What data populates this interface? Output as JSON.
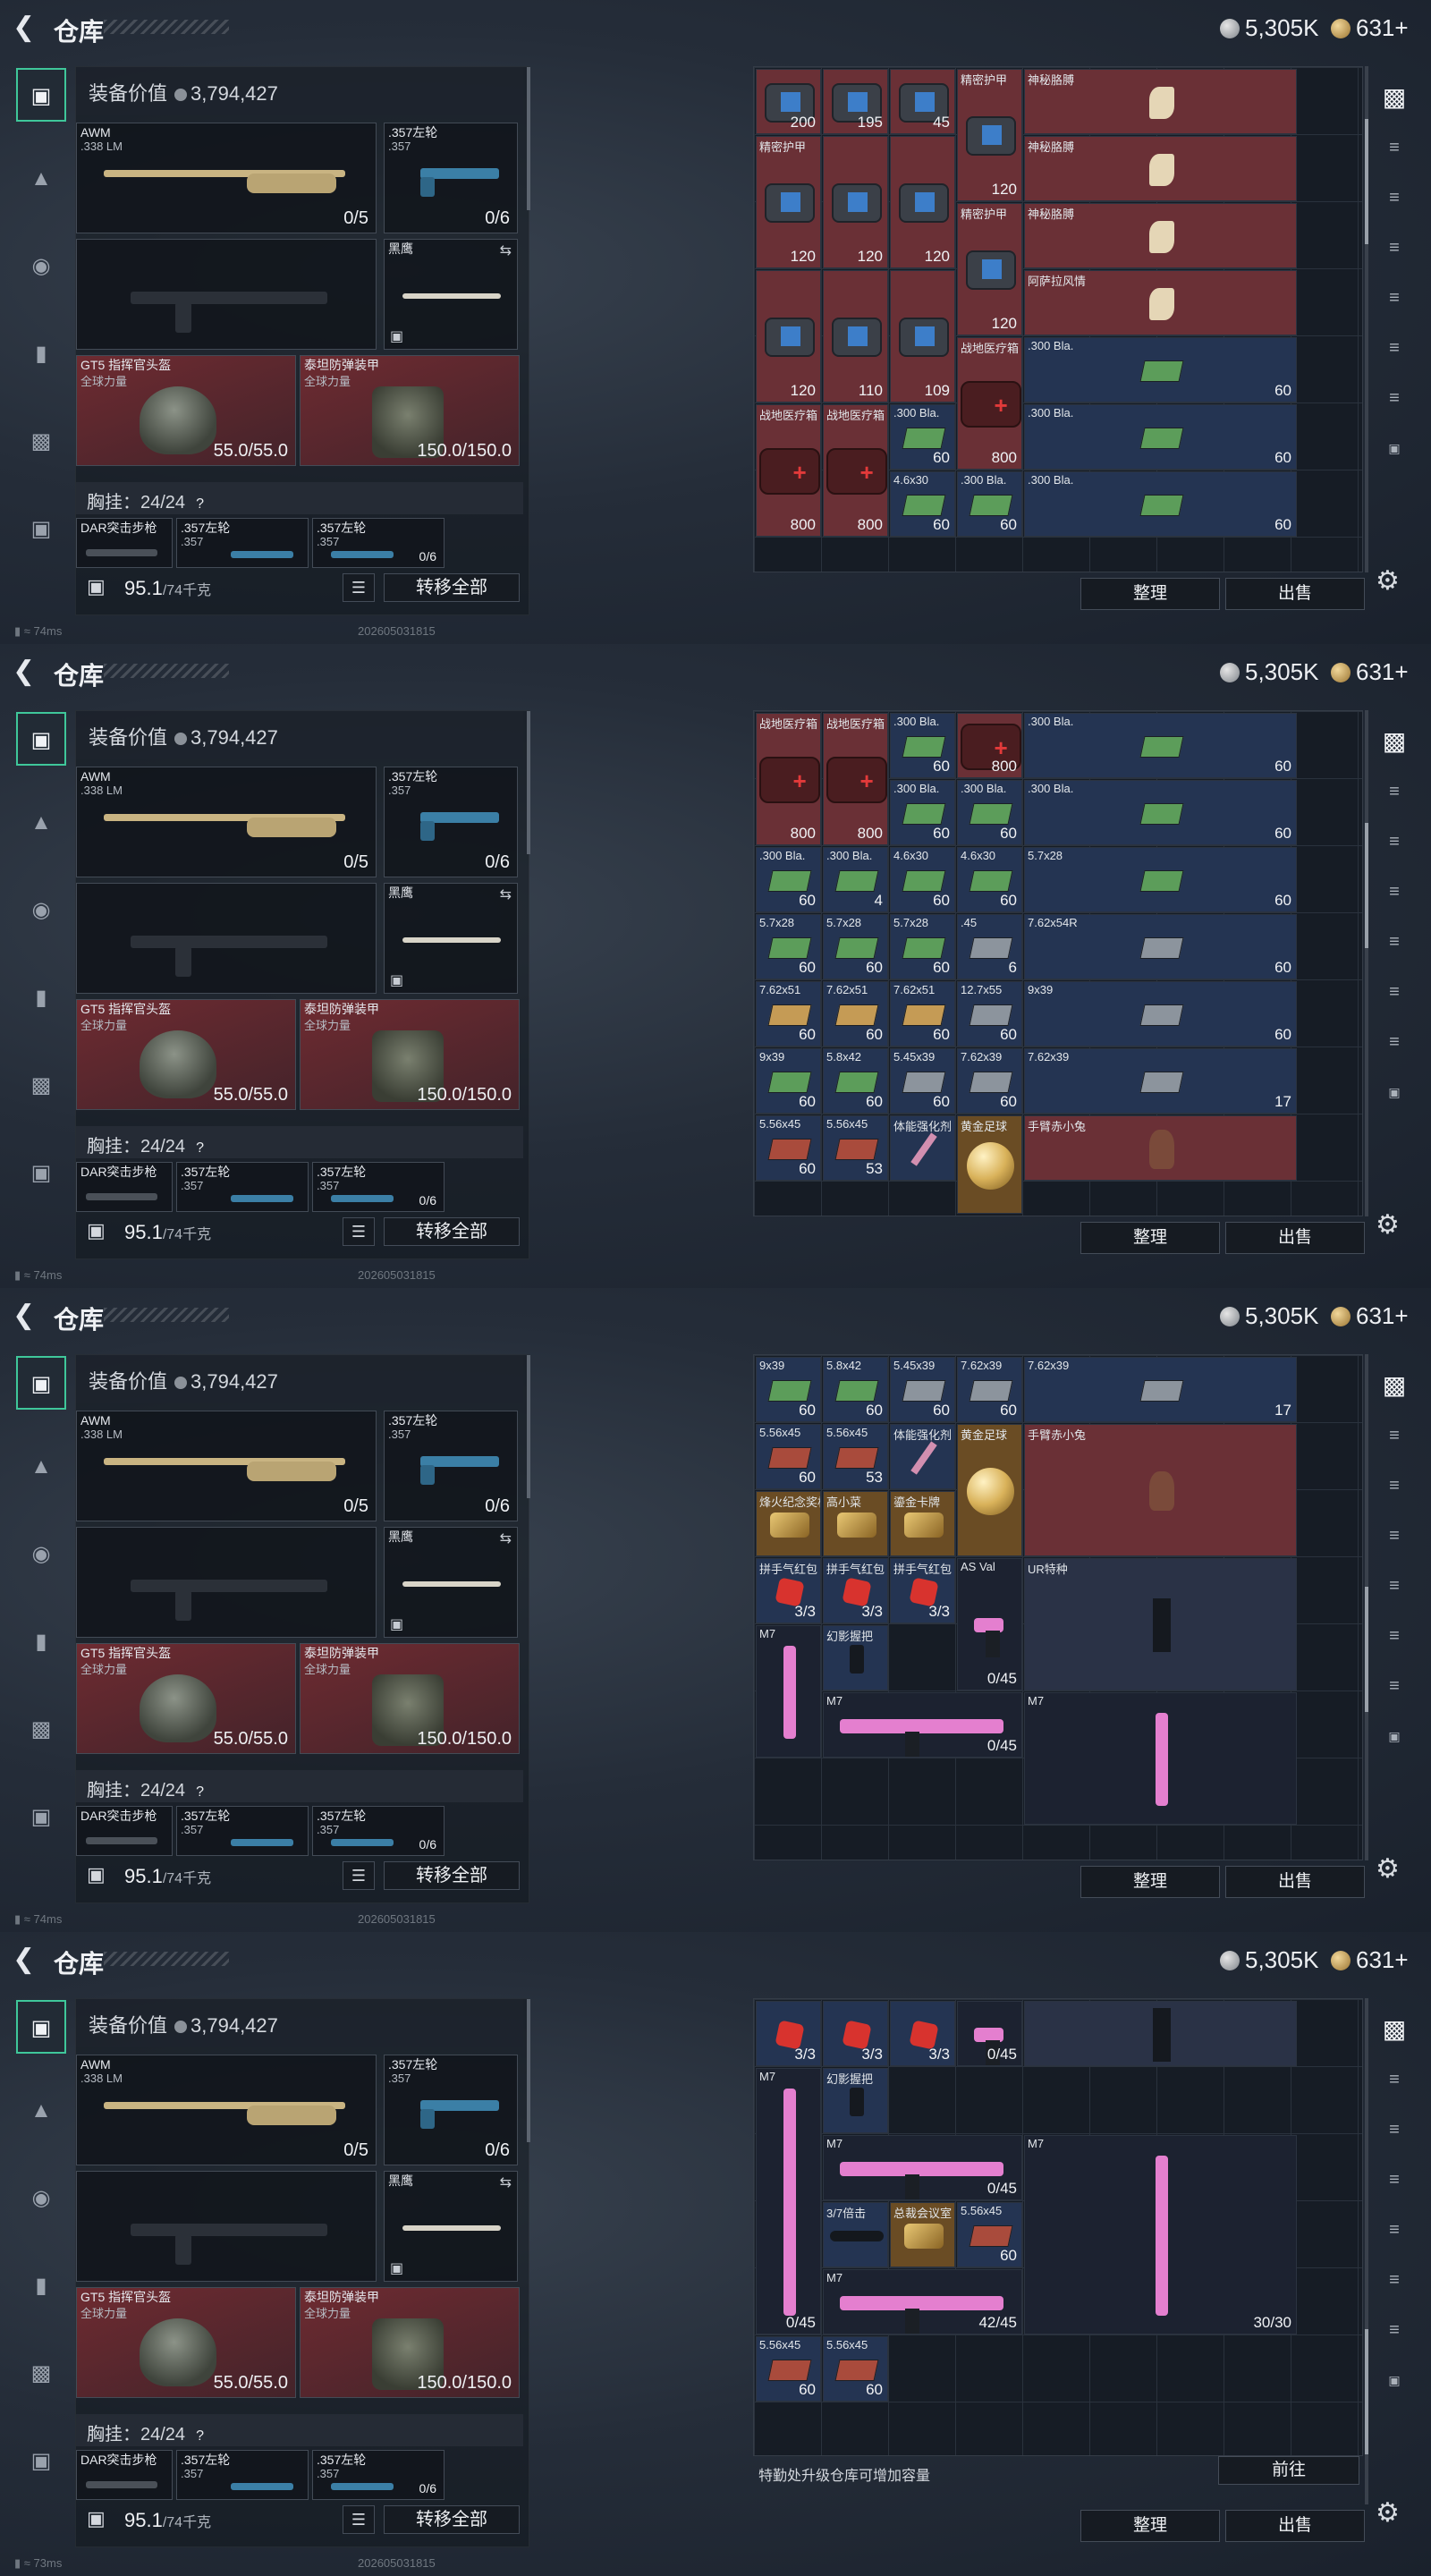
{
  "title": "仓库",
  "currency": {
    "silver": "5,305K",
    "gold": "631+"
  },
  "left": {
    "value_label": "装备价值",
    "value": "3,794,427",
    "slots": {
      "primary": {
        "name": "AWM",
        "sub": ".338 LM",
        "count": "0/5"
      },
      "secondary": {
        "name": ".357左轮",
        "sub": ".357",
        "count": "0/6"
      },
      "melee": {
        "name": "黑鹰"
      },
      "helmet": {
        "name": "GT5 指挥官头盔",
        "sub": "全球力量",
        "durability": "55.0/55.0"
      },
      "armor": {
        "name": "泰坦防弹装甲",
        "sub": "全球力量",
        "durability": "150.0/150.0"
      }
    },
    "chest": {
      "label": "胸挂：",
      "value": "24/24",
      "q": "?"
    },
    "chest_items": [
      {
        "name": "DAR突击步枪"
      },
      {
        "name": ".357左轮",
        "sub": ".357"
      },
      {
        "name": ".357左轮",
        "sub": ".357",
        "count": "0/6"
      }
    ],
    "weight": "95.1",
    "weight_max": "/74千克",
    "transfer_all": "转移全部"
  },
  "status": {
    "ping1": "74ms",
    "ping4": "73ms",
    "timestamp": "202605031815"
  },
  "buttons": {
    "sort": "整理",
    "sell": "出售",
    "goto": "前往"
  },
  "notice": "特勤处升级仓库可增加容量",
  "colors": {
    "accent": "#3fc79a",
    "red_slot": "#6e2b31",
    "pink": "#e47fcf"
  },
  "views": [
    {
      "thumb": 0.14,
      "cells": [
        {
          "c": 0,
          "r": 0,
          "w": 1,
          "h": 1,
          "bg": "#6a3036",
          "icon": "armor-bag",
          "cnt": "200"
        },
        {
          "c": 1,
          "r": 0,
          "w": 1,
          "h": 1,
          "bg": "#6a3036",
          "icon": "armor-bag",
          "cnt": "195"
        },
        {
          "c": 2,
          "r": 0,
          "w": 1,
          "h": 1,
          "bg": "#6a3036",
          "icon": "armor-bag",
          "cnt": "45"
        },
        {
          "c": 3,
          "r": 0,
          "w": 1,
          "h": 2,
          "bg": "#6a3036",
          "icon": "armor-bag",
          "name": "精密护甲",
          "cnt": "120"
        },
        {
          "c": 4,
          "r": 0,
          "w": 1,
          "h": 1,
          "bg": "#6a3036",
          "icon": "arm",
          "name": "神秘胳膊"
        },
        {
          "c": 0,
          "r": 1,
          "w": 1,
          "h": 2,
          "bg": "#6a3036",
          "icon": "armor-bag",
          "name": "精密护甲",
          "cnt": "120"
        },
        {
          "c": 1,
          "r": 1,
          "w": 1,
          "h": 2,
          "bg": "#6a3036",
          "icon": "armor-bag",
          "cnt": "120"
        },
        {
          "c": 2,
          "r": 1,
          "w": 1,
          "h": 2,
          "bg": "#6a3036",
          "icon": "armor-bag",
          "cnt": "120"
        },
        {
          "c": 4,
          "r": 1,
          "w": 1,
          "h": 1,
          "bg": "#6a3036",
          "icon": "arm",
          "name": "神秘胳膊"
        },
        {
          "c": 3,
          "r": 2,
          "w": 1,
          "h": 2,
          "bg": "#6a3036",
          "icon": "armor-bag",
          "name": "精密护甲",
          "cnt": "120"
        },
        {
          "c": 4,
          "r": 2,
          "w": 1,
          "h": 1,
          "bg": "#6a3036",
          "icon": "arm",
          "name": "神秘胳膊"
        },
        {
          "c": 0,
          "r": 3,
          "w": 1,
          "h": 2,
          "bg": "#6a3036",
          "icon": "armor-bag",
          "cnt": "120"
        },
        {
          "c": 1,
          "r": 3,
          "w": 1,
          "h": 2,
          "bg": "#6a3036",
          "icon": "armor-bag",
          "cnt": "110"
        },
        {
          "c": 2,
          "r": 3,
          "w": 1,
          "h": 2,
          "bg": "#6a3036",
          "icon": "armor-bag",
          "cnt": "109"
        },
        {
          "c": 4,
          "r": 3,
          "w": 1,
          "h": 1,
          "bg": "#6a3036",
          "icon": "arm",
          "name": "阿萨拉风情"
        },
        {
          "c": 3,
          "r": 4,
          "w": 1,
          "h": 2,
          "bg": "#6a3036",
          "icon": "medkit",
          "name": "战地医疗箱",
          "cnt": "800"
        },
        {
          "c": 0,
          "r": 5,
          "w": 1,
          "h": 2,
          "bg": "#6a3036",
          "icon": "medkit",
          "name": "战地医疗箱",
          "cnt": "800"
        },
        {
          "c": 1,
          "r": 5,
          "w": 1,
          "h": 2,
          "bg": "#6a3036",
          "icon": "medkit",
          "name": "战地医疗箱",
          "cnt": "800"
        },
        {
          "c": 2,
          "r": 5,
          "w": 1,
          "h": 1,
          "bg": "#243452",
          "icon": "ammo-green",
          "name": ".300 Bla.",
          "cnt": "60"
        },
        {
          "c": 4,
          "r": 4,
          "w": 1,
          "h": 1,
          "bg": "#243452",
          "icon": "ammo-green",
          "name": ".300 Bla.",
          "cnt": "60"
        },
        {
          "c": 4,
          "r": 5,
          "w": 1,
          "h": 1,
          "bg": "#243452",
          "icon": "ammo-green",
          "name": ".300 Bla.",
          "cnt": "60"
        },
        {
          "c": 2,
          "r": 6,
          "w": 1,
          "h": 1,
          "bg": "#243452",
          "icon": "ammo-green",
          "name": "4.6x30",
          "cnt": "60"
        },
        {
          "c": 3,
          "r": 6,
          "w": 1,
          "h": 1,
          "bg": "#243452",
          "icon": "ammo-green",
          "name": ".300 Bla.",
          "cnt": "60"
        },
        {
          "c": 4,
          "r": 6,
          "w": 1,
          "h": 1,
          "bg": "#243452",
          "icon": "ammo-green",
          "name": ".300 Bla.",
          "cnt": "60"
        }
      ]
    },
    {
      "thumb": 0.3,
      "cells": [
        {
          "c": 0,
          "r": 0,
          "w": 1,
          "h": 2,
          "bg": "#6a3036",
          "icon": "medkit",
          "name": "战地医疗箱",
          "cnt": "800"
        },
        {
          "c": 1,
          "r": 0,
          "w": 1,
          "h": 2,
          "bg": "#6a3036",
          "icon": "medkit",
          "name": "战地医疗箱",
          "cnt": "800"
        },
        {
          "c": 2,
          "r": 0,
          "w": 1,
          "h": 1,
          "bg": "#243452",
          "icon": "ammo-green",
          "name": ".300 Bla.",
          "cnt": "60"
        },
        {
          "c": 3,
          "r": 0,
          "w": 1,
          "h": 1,
          "bg": "#6a3036",
          "icon": "medkit",
          "cnt": "800"
        },
        {
          "c": 4,
          "r": 0,
          "w": 1,
          "h": 1,
          "bg": "#243452",
          "icon": "ammo-green",
          "name": ".300 Bla.",
          "cnt": "60"
        },
        {
          "c": 2,
          "r": 1,
          "w": 1,
          "h": 1,
          "bg": "#243452",
          "icon": "ammo-green",
          "name": ".300 Bla.",
          "cnt": "60"
        },
        {
          "c": 3,
          "r": 1,
          "w": 1,
          "h": 1,
          "bg": "#243452",
          "icon": "ammo-green",
          "name": ".300 Bla.",
          "cnt": "60"
        },
        {
          "c": 4,
          "r": 1,
          "w": 1,
          "h": 1,
          "bg": "#243452",
          "icon": "ammo-green",
          "name": ".300 Bla.",
          "cnt": "60"
        },
        {
          "c": 0,
          "r": 2,
          "w": 1,
          "h": 1,
          "bg": "#243452",
          "icon": "ammo-green",
          "name": ".300 Bla.",
          "cnt": "60"
        },
        {
          "c": 1,
          "r": 2,
          "w": 1,
          "h": 1,
          "bg": "#243452",
          "icon": "ammo-green",
          "name": ".300 Bla.",
          "cnt": "4"
        },
        {
          "c": 2,
          "r": 2,
          "w": 1,
          "h": 1,
          "bg": "#243452",
          "icon": "ammo-green",
          "name": "4.6x30",
          "cnt": "60"
        },
        {
          "c": 3,
          "r": 2,
          "w": 1,
          "h": 1,
          "bg": "#243452",
          "icon": "ammo-green",
          "name": "4.6x30",
          "cnt": "60"
        },
        {
          "c": 4,
          "r": 2,
          "w": 1,
          "h": 1,
          "bg": "#243452",
          "icon": "ammo-green",
          "name": "5.7x28",
          "cnt": "60"
        },
        {
          "c": 0,
          "r": 3,
          "w": 1,
          "h": 1,
          "bg": "#243452",
          "icon": "ammo-green",
          "name": "5.7x28",
          "cnt": "60"
        },
        {
          "c": 1,
          "r": 3,
          "w": 1,
          "h": 1,
          "bg": "#243452",
          "icon": "ammo-green",
          "name": "5.7x28",
          "cnt": "60"
        },
        {
          "c": 2,
          "r": 3,
          "w": 1,
          "h": 1,
          "bg": "#243452",
          "icon": "ammo-green",
          "name": "5.7x28",
          "cnt": "60"
        },
        {
          "c": 3,
          "r": 3,
          "w": 1,
          "h": 1,
          "bg": "#243452",
          "icon": "ammo-gray",
          "name": ".45",
          "cnt": "6"
        },
        {
          "c": 4,
          "r": 3,
          "w": 1,
          "h": 1,
          "bg": "#243452",
          "icon": "ammo-gray",
          "name": "7.62x54R",
          "cnt": "60"
        },
        {
          "c": 0,
          "r": 4,
          "w": 1,
          "h": 1,
          "bg": "#243452",
          "icon": "ammo-tan",
          "name": "7.62x51",
          "cnt": "60"
        },
        {
          "c": 1,
          "r": 4,
          "w": 1,
          "h": 1,
          "bg": "#243452",
          "icon": "ammo-tan",
          "name": "7.62x51",
          "cnt": "60"
        },
        {
          "c": 2,
          "r": 4,
          "w": 1,
          "h": 1,
          "bg": "#243452",
          "icon": "ammo-tan",
          "name": "7.62x51",
          "cnt": "60"
        },
        {
          "c": 3,
          "r": 4,
          "w": 1,
          "h": 1,
          "bg": "#243452",
          "icon": "ammo-gray",
          "name": "12.7x55",
          "cnt": "60"
        },
        {
          "c": 4,
          "r": 4,
          "w": 1,
          "h": 1,
          "bg": "#243452",
          "icon": "ammo-gray",
          "name": "9x39",
          "cnt": "60"
        },
        {
          "c": 0,
          "r": 5,
          "w": 1,
          "h": 1,
          "bg": "#243452",
          "icon": "ammo-green",
          "name": "9x39",
          "cnt": "60"
        },
        {
          "c": 1,
          "r": 5,
          "w": 1,
          "h": 1,
          "bg": "#243452",
          "icon": "ammo-green",
          "name": "5.8x42",
          "cnt": "60"
        },
        {
          "c": 2,
          "r": 5,
          "w": 1,
          "h": 1,
          "bg": "#243452",
          "icon": "ammo-gray",
          "name": "5.45x39",
          "cnt": "60"
        },
        {
          "c": 3,
          "r": 5,
          "w": 1,
          "h": 1,
          "bg": "#243452",
          "icon": "ammo-gray",
          "name": "7.62x39",
          "cnt": "60"
        },
        {
          "c": 4,
          "r": 5,
          "w": 1,
          "h": 1,
          "bg": "#243452",
          "icon": "ammo-gray",
          "name": "7.62x39",
          "cnt": "17"
        },
        {
          "c": 0,
          "r": 6,
          "w": 1,
          "h": 1,
          "bg": "#243452",
          "icon": "ammo-red",
          "name": "5.56x45",
          "cnt": "60"
        },
        {
          "c": 1,
          "r": 6,
          "w": 1,
          "h": 1,
          "bg": "#243452",
          "icon": "ammo-red",
          "name": "5.56x45",
          "cnt": "53"
        },
        {
          "c": 2,
          "r": 6,
          "w": 1,
          "h": 1,
          "bg": "#243452",
          "icon": "syringe",
          "name": "体能强化剂"
        },
        {
          "c": 3,
          "r": 6,
          "w": 1,
          "h": 2,
          "bg": "#6a4c24",
          "icon": "gold-ball",
          "name": "黄金足球"
        },
        {
          "c": 4,
          "r": 6,
          "w": 1,
          "h": 1,
          "bg": "#6a3036",
          "icon": "figure",
          "name": "手臂赤小兔"
        }
      ]
    },
    {
      "thumb": 0.62,
      "cells": [
        {
          "c": 0,
          "r": 0,
          "w": 1,
          "h": 1,
          "bg": "#243452",
          "icon": "ammo-green",
          "name": "9x39",
          "cnt": "60"
        },
        {
          "c": 1,
          "r": 0,
          "w": 1,
          "h": 1,
          "bg": "#243452",
          "icon": "ammo-green",
          "name": "5.8x42",
          "cnt": "60"
        },
        {
          "c": 2,
          "r": 0,
          "w": 1,
          "h": 1,
          "bg": "#243452",
          "icon": "ammo-gray",
          "name": "5.45x39",
          "cnt": "60"
        },
        {
          "c": 3,
          "r": 0,
          "w": 1,
          "h": 1,
          "bg": "#243452",
          "icon": "ammo-gray",
          "name": "7.62x39",
          "cnt": "60"
        },
        {
          "c": 4,
          "r": 0,
          "w": 1,
          "h": 1,
          "bg": "#243452",
          "icon": "ammo-gray",
          "name": "7.62x39",
          "cnt": "17"
        },
        {
          "c": 0,
          "r": 1,
          "w": 1,
          "h": 1,
          "bg": "#243452",
          "icon": "ammo-red",
          "name": "5.56x45",
          "cnt": "60"
        },
        {
          "c": 1,
          "r": 1,
          "w": 1,
          "h": 1,
          "bg": "#243452",
          "icon": "ammo-red",
          "name": "5.56x45",
          "cnt": "53"
        },
        {
          "c": 2,
          "r": 1,
          "w": 1,
          "h": 1,
          "bg": "#243452",
          "icon": "syringe",
          "name": "体能强化剂"
        },
        {
          "c": 3,
          "r": 1,
          "w": 1,
          "h": 2,
          "bg": "#6a4c24",
          "icon": "gold-ball",
          "name": "黄金足球"
        },
        {
          "c": 4,
          "r": 1,
          "w": 1,
          "h": 2,
          "bg": "#6a3036",
          "icon": "figure",
          "name": "手臂赤小兔"
        },
        {
          "c": 0,
          "r": 2,
          "w": 1,
          "h": 1,
          "bg": "#6a4c24",
          "icon": "trophy",
          "name": "烽火纪念奖杯"
        },
        {
          "c": 1,
          "r": 2,
          "w": 1,
          "h": 1,
          "bg": "#6a4c24",
          "icon": "trophy",
          "name": "高小菜"
        },
        {
          "c": 2,
          "r": 2,
          "w": 1,
          "h": 1,
          "bg": "#6a4c24",
          "icon": "trophy",
          "name": "鎏金卡牌"
        },
        {
          "c": 0,
          "r": 3,
          "w": 1,
          "h": 1,
          "bg": "#243452",
          "icon": "redpack",
          "name": "拼手气红包",
          "cnt": "3/3"
        },
        {
          "c": 1,
          "r": 3,
          "w": 1,
          "h": 1,
          "bg": "#243452",
          "icon": "redpack",
          "name": "拼手气红包",
          "cnt": "3/3"
        },
        {
          "c": 2,
          "r": 3,
          "w": 1,
          "h": 1,
          "bg": "#243452",
          "icon": "redpack",
          "name": "拼手气红包",
          "cnt": "3/3"
        },
        {
          "c": 3,
          "r": 3,
          "w": 1,
          "h": 2,
          "bg": "#1c2230",
          "icon": "pink-gun",
          "name": "AS Val",
          "cnt": "0/45"
        },
        {
          "c": 4,
          "r": 3,
          "w": 1,
          "h": 2,
          "bg": "#2a3246",
          "icon": "stock",
          "name": "UR特种"
        },
        {
          "c": 0,
          "r": 4,
          "w": 1,
          "h": 2,
          "bg": "#1c2230",
          "icon": "pink-gun-v",
          "name": "M7"
        },
        {
          "c": 1,
          "r": 4,
          "w": 1,
          "h": 1,
          "bg": "#243452",
          "icon": "grip",
          "name": "幻影握把"
        },
        {
          "c": 1,
          "r": 5,
          "w": 3,
          "h": 1,
          "bg": "#1c2230",
          "icon": "pink-gun",
          "name": "M7",
          "cnt": "0/45"
        },
        {
          "c": 4,
          "r": 5,
          "w": 1,
          "h": 2,
          "bg": "#1c2230",
          "icon": "pink-gun-v",
          "name": "M7"
        }
      ]
    },
    {
      "thumb": 0.88,
      "cells": [
        {
          "c": 0,
          "r": 0,
          "w": 1,
          "h": 1,
          "bg": "#243452",
          "icon": "redpack",
          "cnt": "3/3"
        },
        {
          "c": 1,
          "r": 0,
          "w": 1,
          "h": 1,
          "bg": "#243452",
          "icon": "redpack",
          "cnt": "3/3"
        },
        {
          "c": 2,
          "r": 0,
          "w": 1,
          "h": 1,
          "bg": "#243452",
          "icon": "redpack",
          "cnt": "3/3"
        },
        {
          "c": 3,
          "r": 0,
          "w": 1,
          "h": 1,
          "bg": "#1c2230",
          "icon": "pink-gun",
          "cnt": "0/45"
        },
        {
          "c": 4,
          "r": 0,
          "w": 1,
          "h": 1,
          "bg": "#2a3246",
          "icon": "stock"
        },
        {
          "c": 0,
          "r": 1,
          "w": 1,
          "h": 4,
          "bg": "#1c2230",
          "icon": "pink-gun-v",
          "name": "M7",
          "cnt": "0/45"
        },
        {
          "c": 1,
          "r": 1,
          "w": 1,
          "h": 1,
          "bg": "#243452",
          "icon": "grip",
          "name": "幻影握把"
        },
        {
          "c": 1,
          "r": 2,
          "w": 3,
          "h": 1,
          "bg": "#1c2230",
          "icon": "pink-gun",
          "name": "M7",
          "cnt": "0/45"
        },
        {
          "c": 4,
          "r": 2,
          "w": 1,
          "h": 3,
          "bg": "#1c2230",
          "icon": "pink-gun-v",
          "name": "M7",
          "cnt": "30/30"
        },
        {
          "c": 1,
          "r": 3,
          "w": 1,
          "h": 1,
          "bg": "#243452",
          "icon": "scope",
          "name": "3/7倍击"
        },
        {
          "c": 2,
          "r": 3,
          "w": 1,
          "h": 1,
          "bg": "#6a4c24",
          "icon": "trophy",
          "name": "总裁会议室"
        },
        {
          "c": 3,
          "r": 3,
          "w": 1,
          "h": 1,
          "bg": "#243452",
          "icon": "ammo-red",
          "name": "5.56x45",
          "cnt": "60"
        },
        {
          "c": 1,
          "r": 4,
          "w": 3,
          "h": 1,
          "bg": "#1c2230",
          "icon": "pink-gun",
          "name": "M7",
          "cnt": "42/45"
        },
        {
          "c": 0,
          "r": 5,
          "w": 1,
          "h": 1,
          "bg": "#243452",
          "icon": "ammo-red",
          "name": "5.56x45",
          "cnt": "60"
        },
        {
          "c": 1,
          "r": 5,
          "w": 1,
          "h": 1,
          "bg": "#243452",
          "icon": "ammo-red",
          "name": "5.56x45",
          "cnt": "60"
        }
      ]
    }
  ]
}
